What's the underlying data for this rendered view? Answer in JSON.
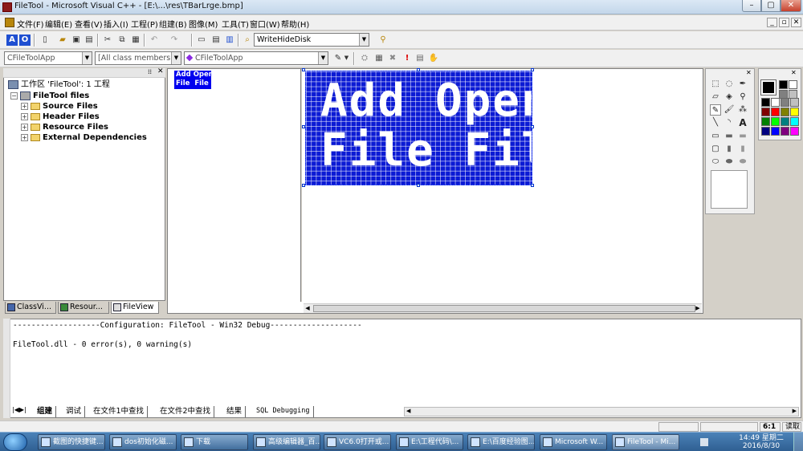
{
  "window": {
    "title": "FileTool - Microsoft Visual C++ - [E:\\...\\res\\TBarLrge.bmp]",
    "controls": {
      "minimize": "–",
      "maximize": "▢",
      "close": "✕"
    }
  },
  "menu": {
    "items": [
      "文件(F)",
      "编辑(E)",
      "查看(V)",
      "插入(I)",
      "工程(P)",
      "组建(B)",
      "图像(M)",
      "工具(T)",
      "窗口(W)",
      "帮助(H)"
    ],
    "mdi_controls": {
      "minimize": "_",
      "restore": "▫",
      "close": "✕"
    }
  },
  "toolbar": {
    "find_combo_value": "WriteHideDisk"
  },
  "wizardbar": {
    "class_combo": "CFileToolApp",
    "members_combo": "[All class members]",
    "function_combo": "CFileToolApp"
  },
  "workspace": {
    "root": "工作区 'FileTool': 1 工程",
    "project": "FileTool files",
    "folders": [
      "Source Files",
      "Header Files",
      "Resource Files",
      "External Dependencies"
    ],
    "tabs": [
      "ClassVi...",
      "Resour...",
      "FileView"
    ],
    "active_tab": "FileView"
  },
  "editor": {
    "small_preview": "Add Open\nFile  File",
    "bitmap_text": "Add Open\nFile File",
    "bitmap_bg": "#0b1ad4"
  },
  "output": {
    "lines": [
      "-------------------Configuration: FileTool - Win32 Debug--------------------",
      "",
      "FileTool.dll - 0 error(s), 0 warning(s)"
    ],
    "tabs": [
      "组建",
      "调试",
      "在文件1中查找",
      "在文件2中查找",
      "结果",
      "SQL Debugging"
    ],
    "active_tab": "组建"
  },
  "statusbar": {
    "zoom": "6:1",
    "mode": "读取"
  },
  "palette_colors": [
    "#000000",
    "#ffffff",
    "#808080",
    "#c0c0c0",
    "#800000",
    "#ff0000",
    "#808000",
    "#ffff00",
    "#008000",
    "#00ff00",
    "#008080",
    "#00ffff",
    "#000080",
    "#0000ff",
    "#800080",
    "#ff00ff"
  ],
  "taskbar": {
    "tasks": [
      "截图的快捷键...",
      "dos初始化磁...",
      "下载",
      "高级编辑器_百...",
      "VC6.0打开或...",
      "E:\\工程代码\\...",
      "E:\\百度经验图...",
      "Microsoft W...",
      "FileTool - Mi..."
    ],
    "active_task": "FileTool - Mi...",
    "clock_time": "14:49 星期二",
    "clock_date": "2016/8/30"
  }
}
